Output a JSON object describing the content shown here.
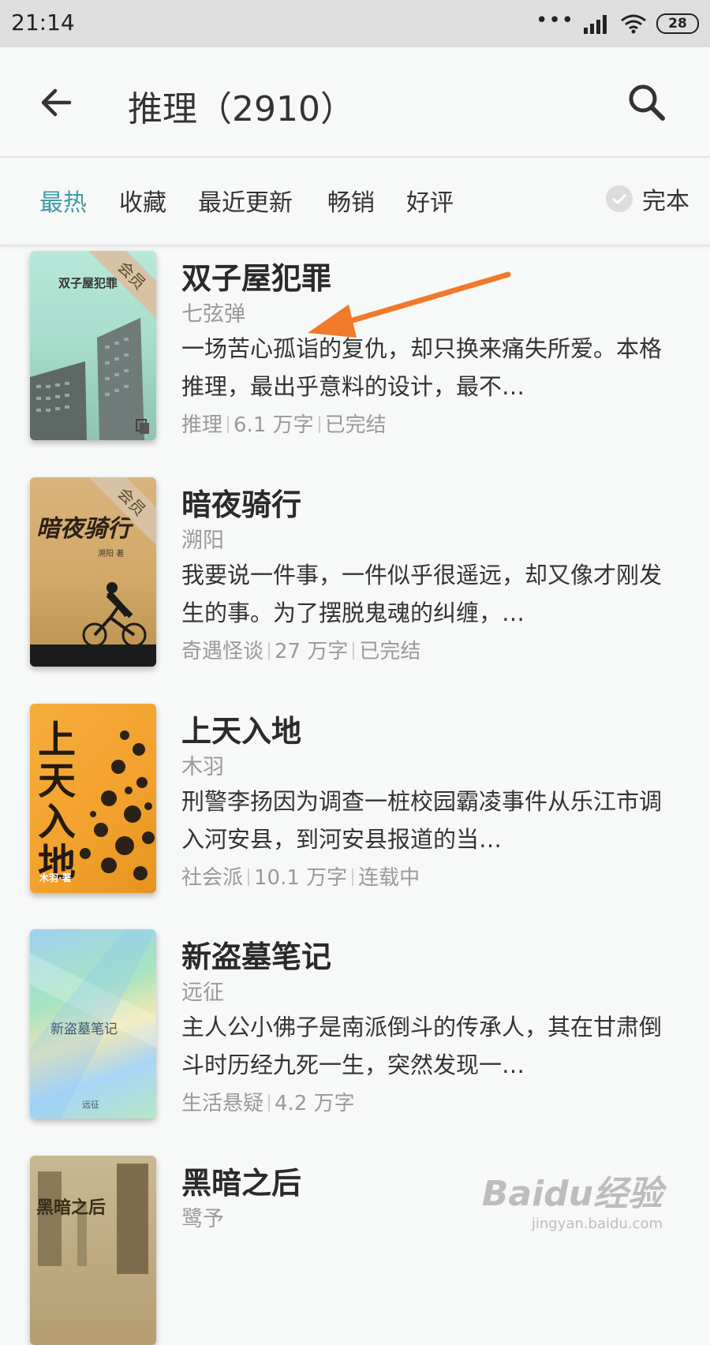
{
  "status_bar": {
    "time": "21:14",
    "signal_dots": "•••",
    "battery": "28"
  },
  "header": {
    "title": "推理（2910）"
  },
  "filters": {
    "tabs": [
      {
        "label": "最热",
        "active": true
      },
      {
        "label": "收藏"
      },
      {
        "label": "最近更新"
      },
      {
        "label": "畅销"
      },
      {
        "label": "好评"
      }
    ],
    "complete_label": "完本"
  },
  "books": [
    {
      "title": "双子屋犯罪",
      "author": "七弦弹",
      "description": "一场苦心孤诣的复仇，却只换来痛失所爱。本格推理，最出乎意料的设计，最不…",
      "genre": "推理",
      "words": "6.1 万字",
      "status": "已完结",
      "member_badge": "会员",
      "cover_text": "双子屋犯罪"
    },
    {
      "title": "暗夜骑行",
      "author": "溯阳",
      "description": "我要说一件事，一件似乎很遥远，却又像才刚发生的事。为了摆脱鬼魂的纠缠，…",
      "genre": "奇遇怪谈",
      "words": "27 万字",
      "status": "已完结",
      "member_badge": "会员",
      "cover_text": "暗夜骑行",
      "cover_author": "溯阳 著"
    },
    {
      "title": "上天入地",
      "author": "木羽",
      "description": "刑警李扬因为调查一桩校园霸凌事件从乐江市调入河安县，到河安县报道的当…",
      "genre": "社会派",
      "words": "10.1 万字",
      "status": "连载中",
      "cover_text": "上天入地",
      "cover_author": "木羽·著"
    },
    {
      "title": "新盗墓笔记",
      "author": "远征",
      "description": "主人公小佛子是南派倒斗的传承人，其在甘肃倒斗时历经九死一生，突然发现一…",
      "genre": "生活悬疑",
      "words": "4.2 万字",
      "cover_text": "新盗墓笔记",
      "cover_author": "远征"
    },
    {
      "title": "黑暗之后",
      "author": "鹭予",
      "cover_text": "黑暗之后"
    }
  ],
  "watermark": {
    "logo": "Baidu经验",
    "url": "jingyan.baidu.com"
  },
  "colors": {
    "accent": "#3f9aa6",
    "annotation_arrow": "#f07a2a",
    "member_ribbon": "#d7c2a6"
  }
}
